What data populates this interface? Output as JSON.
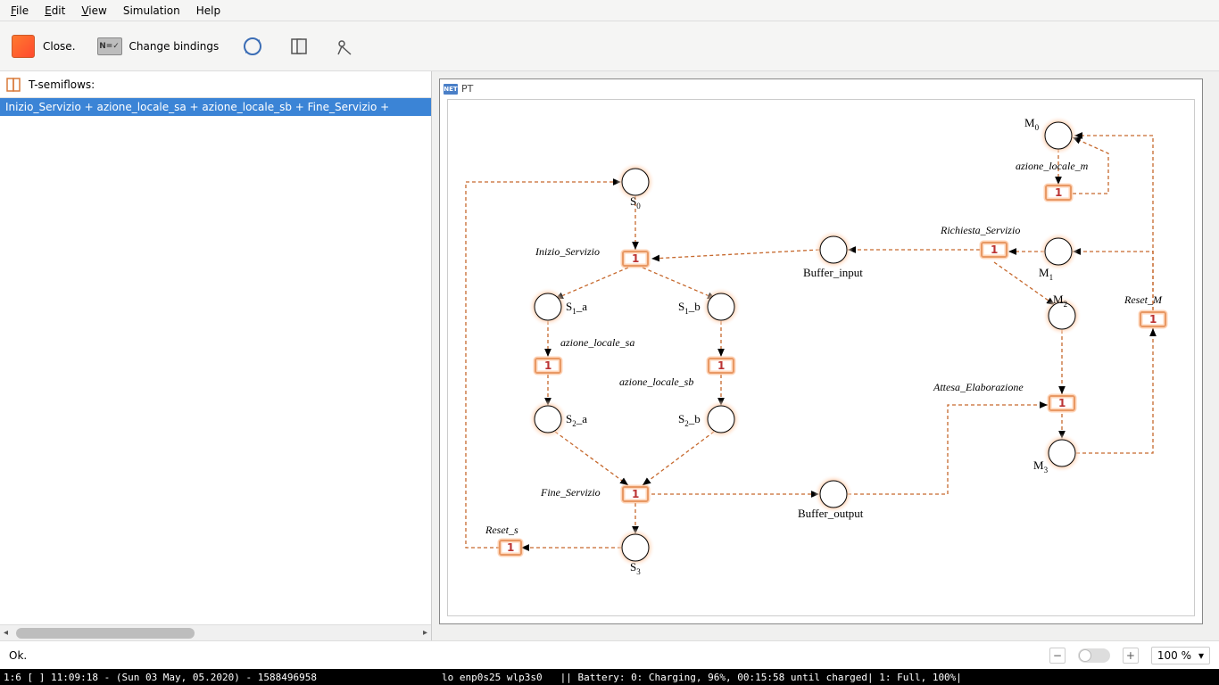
{
  "menu": {
    "file": "File",
    "edit": "Edit",
    "view": "View",
    "simulation": "Simulation",
    "help": "Help"
  },
  "toolbar": {
    "close": "Close.",
    "bindings": "Change bindings"
  },
  "left": {
    "head": "T-semiflows:",
    "item0": "Inizio_Servizio + azione_locale_sa + azione_locale_sb + Fine_Servizio + "
  },
  "net": {
    "title": "PT"
  },
  "places": {
    "S0": "S",
    "S0s": "0",
    "S1a": "S",
    "S1as": "1",
    "S1at": "_a",
    "S1b": "S",
    "S1bs": "1",
    "S1bt": "_b",
    "S2a": "S",
    "S2as": "2",
    "S2at": "_a",
    "S2b": "S",
    "S2bs": "2",
    "S2bt": "_b",
    "S3": "S",
    "S3s": "3",
    "Bin": "Buffer_input",
    "Bout": "Buffer_output",
    "M0": "M",
    "M0s": "0",
    "M1": "M",
    "M1s": "1",
    "M2": "M",
    "M2s": "2",
    "M3": "M",
    "M3s": "3"
  },
  "trans": {
    "inizio": "Inizio_Servizio",
    "asa": "azione_locale_sa",
    "asb": "azione_locale_sb",
    "fine": "Fine_Servizio",
    "resets": "Reset_s",
    "rich": "Richiesta_Servizio",
    "attesa": "Attesa_Elaborazione",
    "am": "azione_locale_m",
    "resetm": "Reset_M",
    "one": "1"
  },
  "status": {
    "ok": "Ok."
  },
  "zoom": {
    "value": "100 %"
  },
  "system": {
    "left": "1:6 [ ]    11:09:18 - (Sun 03 May, 05.2020) - 1588496958",
    "mid": "lo enp0s25 wlp3s0",
    "right": "||   Battery: 0: Charging, 96%, 00:15:58 until charged| 1: Full, 100%|"
  }
}
